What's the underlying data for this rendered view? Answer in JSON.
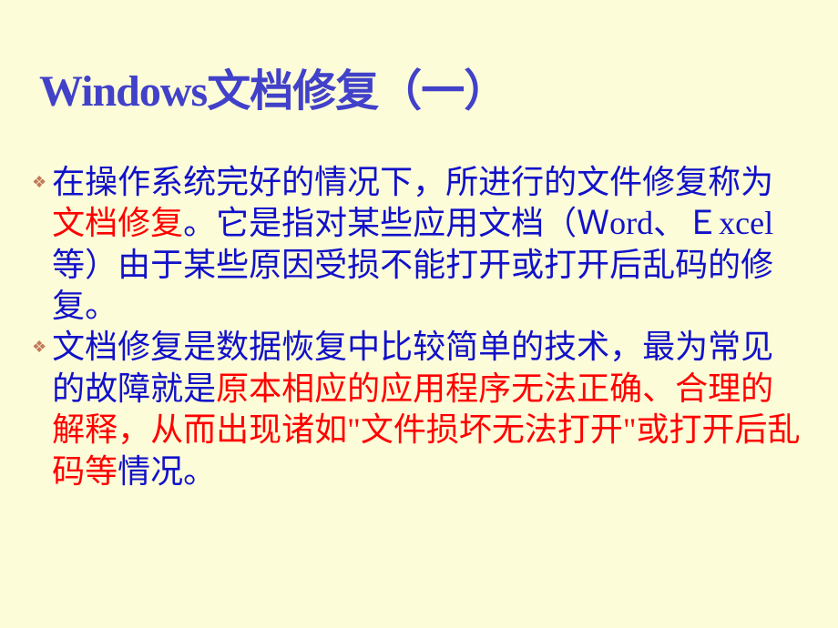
{
  "title": "Windows文档修复（一）",
  "bullets": [
    {
      "segments": [
        {
          "text": "在操作系统完好的情况下，所进行的文件修复称为",
          "highlight": false
        },
        {
          "text": "文档修复",
          "highlight": true
        },
        {
          "text": "。它是指对某些应用文档（Ｗord、Ｅxcel等）由于某些原因受损不能打开或打开后乱码的修复。",
          "highlight": false
        }
      ]
    },
    {
      "segments": [
        {
          "text": "文档修复是数据恢复中比较简单的技术，最为常见的故障就是",
          "highlight": false
        },
        {
          "text": "原本相应的应用程序无法正确、合理的解释，从而出现诸如\"文件损坏无法打开\"或打开后乱码等",
          "highlight": true
        },
        {
          "text": "情况。",
          "highlight": false
        }
      ]
    }
  ]
}
